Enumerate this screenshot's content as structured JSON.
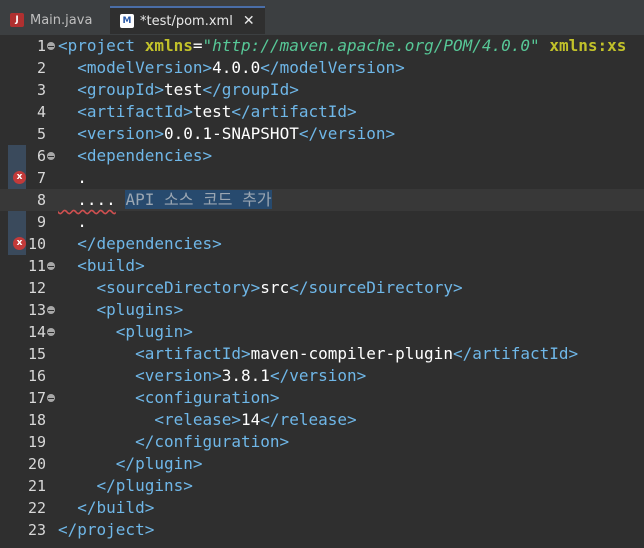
{
  "tabs": [
    {
      "label": "Main.java",
      "icon": "java-file-icon",
      "active": false
    },
    {
      "label": "*test/pom.xml",
      "icon": "maven-pom-icon",
      "active": true,
      "close": "✕"
    }
  ],
  "gutter": {
    "fold_marker": "⊖",
    "error_marker": "x"
  },
  "lines": [
    {
      "n": "1",
      "fold": true,
      "code": [
        [
          "t",
          "<project "
        ],
        [
          "a",
          "xmlns"
        ],
        [
          "x",
          "="
        ],
        [
          "v",
          "\"http://maven.apache.org/POM/4.0.0\""
        ],
        [
          "x",
          " "
        ],
        [
          "a",
          "xmlns:xs"
        ]
      ]
    },
    {
      "n": "2",
      "code": [
        [
          "x",
          "  "
        ],
        [
          "t",
          "<modelVersion>"
        ],
        [
          "x",
          "4.0.0"
        ],
        [
          "t",
          "</modelVersion>"
        ]
      ]
    },
    {
      "n": "3",
      "code": [
        [
          "x",
          "  "
        ],
        [
          "t",
          "<groupId>"
        ],
        [
          "x",
          "test"
        ],
        [
          "t",
          "</groupId>"
        ]
      ]
    },
    {
      "n": "4",
      "code": [
        [
          "x",
          "  "
        ],
        [
          "t",
          "<artifactId>"
        ],
        [
          "x",
          "test"
        ],
        [
          "t",
          "</artifactId>"
        ]
      ]
    },
    {
      "n": "5",
      "code": [
        [
          "x",
          "  "
        ],
        [
          "t",
          "<version>"
        ],
        [
          "x",
          "0.0.1-SNAPSHOT"
        ],
        [
          "t",
          "</version>"
        ]
      ]
    },
    {
      "n": "6",
      "fold": true,
      "code": [
        [
          "x",
          "  "
        ],
        [
          "t",
          "<dependencies>"
        ]
      ]
    },
    {
      "n": "7",
      "error": true,
      "code": [
        [
          "x",
          "  ."
        ]
      ]
    },
    {
      "n": "8",
      "current": true,
      "code": [
        [
          "sq",
          "  ...."
        ],
        [
          "x",
          " "
        ],
        [
          "sel",
          "API 소스 코드 추가"
        ]
      ]
    },
    {
      "n": "9",
      "code": [
        [
          "x",
          "  ."
        ]
      ]
    },
    {
      "n": "10",
      "error": true,
      "code": [
        [
          "x",
          "  "
        ],
        [
          "t",
          "</dependencies>"
        ]
      ]
    },
    {
      "n": "11",
      "fold": true,
      "code": [
        [
          "x",
          "  "
        ],
        [
          "t",
          "<build>"
        ]
      ]
    },
    {
      "n": "12",
      "code": [
        [
          "x",
          "    "
        ],
        [
          "t",
          "<sourceDirectory>"
        ],
        [
          "x",
          "src"
        ],
        [
          "t",
          "</sourceDirectory>"
        ]
      ]
    },
    {
      "n": "13",
      "fold": true,
      "code": [
        [
          "x",
          "    "
        ],
        [
          "t",
          "<plugins>"
        ]
      ]
    },
    {
      "n": "14",
      "fold": true,
      "code": [
        [
          "x",
          "      "
        ],
        [
          "t",
          "<plugin>"
        ]
      ]
    },
    {
      "n": "15",
      "code": [
        [
          "x",
          "        "
        ],
        [
          "t",
          "<artifactId>"
        ],
        [
          "x",
          "maven-compiler-plugin"
        ],
        [
          "t",
          "</artifactId>"
        ]
      ]
    },
    {
      "n": "16",
      "code": [
        [
          "x",
          "        "
        ],
        [
          "t",
          "<version>"
        ],
        [
          "x",
          "3.8.1"
        ],
        [
          "t",
          "</version>"
        ]
      ]
    },
    {
      "n": "17",
      "fold": true,
      "code": [
        [
          "x",
          "        "
        ],
        [
          "t",
          "<configuration>"
        ]
      ]
    },
    {
      "n": "18",
      "code": [
        [
          "x",
          "          "
        ],
        [
          "t",
          "<release>"
        ],
        [
          "x",
          "14"
        ],
        [
          "t",
          "</release>"
        ]
      ]
    },
    {
      "n": "19",
      "code": [
        [
          "x",
          "        "
        ],
        [
          "t",
          "</configuration>"
        ]
      ]
    },
    {
      "n": "20",
      "code": [
        [
          "x",
          "      "
        ],
        [
          "t",
          "</plugin>"
        ]
      ]
    },
    {
      "n": "21",
      "code": [
        [
          "x",
          "    "
        ],
        [
          "t",
          "</plugins>"
        ]
      ]
    },
    {
      "n": "22",
      "code": [
        [
          "x",
          "  "
        ],
        [
          "t",
          "</build>"
        ]
      ]
    },
    {
      "n": "23",
      "code": [
        [
          "t",
          "</project>"
        ]
      ]
    }
  ]
}
